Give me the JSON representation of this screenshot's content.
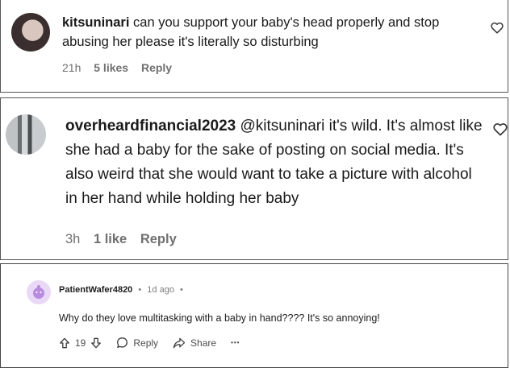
{
  "comment1": {
    "username": "kitsuninari",
    "text": " can you support your baby's head properly and stop abusing her please it's literally so disturbing",
    "time": "21h",
    "likes": "5 likes",
    "reply": "Reply",
    "avatar_icon": "profile-photo",
    "like_icon": "heart-outline-icon"
  },
  "comment2": {
    "username": "overheardfinancial2023",
    "text": " @kitsuninari it's wild. It's almost like she had a baby for the sake of posting on social media. It's also weird that she would want to take a picture with alcohol in her hand while holding her baby",
    "time": "3h",
    "likes": "1 like",
    "reply": "Reply",
    "avatar_icon": "profile-photo",
    "like_icon": "heart-outline-icon"
  },
  "reddit_comment": {
    "username": "PatientWafer4820",
    "dot": "•",
    "time": "1d ago",
    "trailing_dot": "•",
    "text": "Why do they love multitasking with a baby in hand???? It's so annoying!",
    "votes": "19",
    "reply": "Reply",
    "share": "Share",
    "more": "•••",
    "avatar_color": "#e9d9f7",
    "icons": [
      "upvote-icon",
      "downvote-icon",
      "comment-icon",
      "share-icon",
      "more-icon"
    ]
  }
}
